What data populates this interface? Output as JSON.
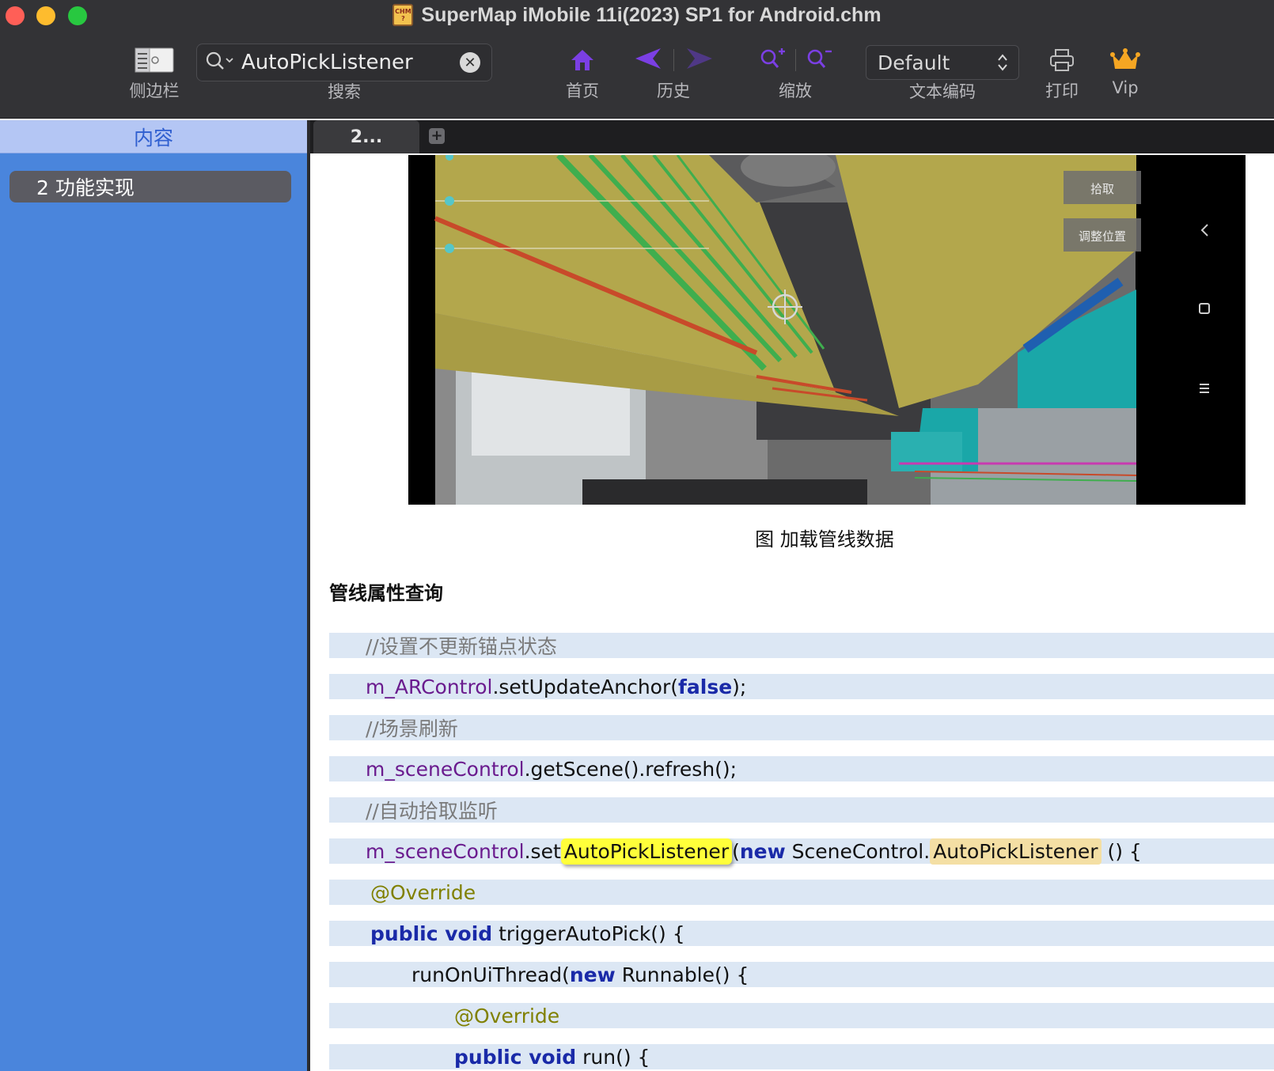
{
  "window": {
    "title": "SuperMap iMobile 11i(2023) SP1 for Android.chm",
    "app_icon_text": [
      "CHM",
      "?"
    ]
  },
  "toolbar": {
    "sidebar_label": "侧边栏",
    "search_label": "搜索",
    "search_value": "AutoPickListener",
    "home_label": "首页",
    "history_label": "历史",
    "zoom_label": "缩放",
    "encoding_label": "文本编码",
    "encoding_value": "Default",
    "print_label": "打印",
    "vip_label": "Vip",
    "icons": [
      "sidebar-icon",
      "search-icon",
      "clear-icon",
      "home-icon",
      "back-arrow-icon",
      "forward-arrow-icon",
      "zoom-in-icon",
      "zoom-out-icon",
      "updown-chevron-icon",
      "printer-icon",
      "crown-icon"
    ],
    "accent_color": "#7b3fe4"
  },
  "sidebar": {
    "header": "内容",
    "items": [
      {
        "label": "2 功能实现"
      }
    ]
  },
  "tabs": [
    {
      "label": "2..."
    }
  ],
  "content": {
    "image_buttons": [
      "拾取",
      "调整位置"
    ],
    "caption": "图  加载管线数据",
    "section_heading": "管线属性查询",
    "code": {
      "l1": "//设置不更新锚点状态",
      "l2_field": "m_ARControl",
      "l2_a": ".setUpdateAnchor(",
      "l2_kw": "false",
      "l2_b": ");",
      "l3": "//场景刷新",
      "l4_field": "m_sceneControl",
      "l4_a": ".getScene().refresh();",
      "l5": "//自动拾取监听",
      "l6_field": "m_sceneControl",
      "l6_a": ".set",
      "l6_hl1": "AutoPickListener",
      "l6_b": "(",
      "l6_kw": "new",
      "l6_c": " SceneControl.",
      "l6_hl2": "AutoPickListener",
      "l6_d": " () {",
      "l7": "@Override",
      "l8_kw": "public void",
      "l8_a": " triggerAutoPick() {",
      "l9_a": "runOnUiThread(",
      "l9_kw": "new",
      "l9_b": " Runnable() {",
      "l10": "@Override",
      "l11_kw": "public void",
      "l11_a": " run() {"
    }
  }
}
